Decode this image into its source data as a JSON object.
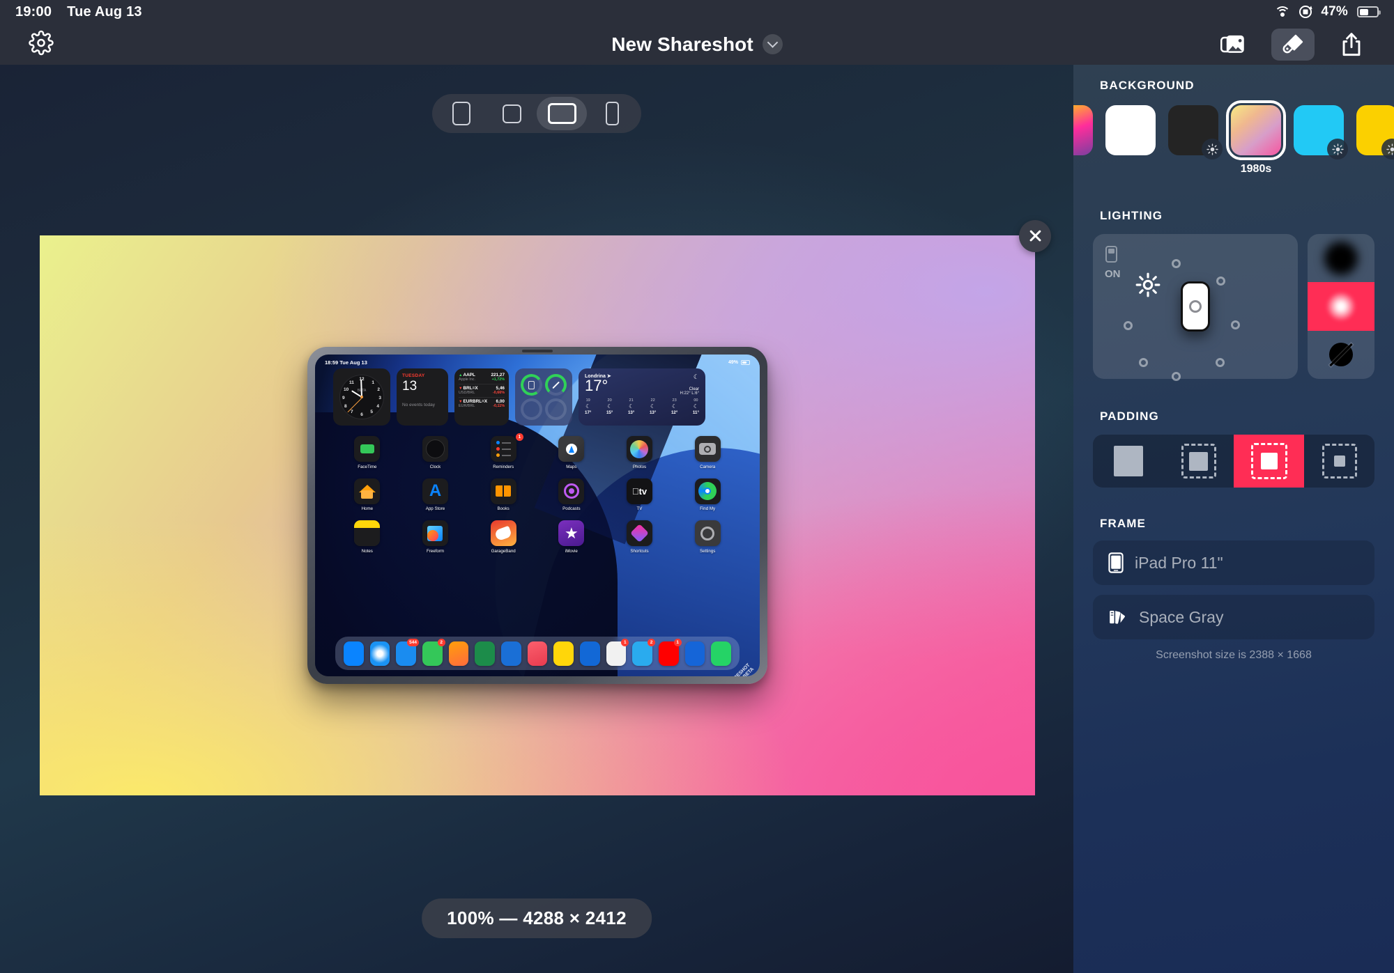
{
  "status_bar": {
    "time": "19:00",
    "date": "Tue Aug 13",
    "battery_percent": "47%",
    "wifi_icon": "wifi-icon",
    "rotation_lock_icon": "rotation-lock-icon",
    "battery_icon": "battery-icon"
  },
  "toolbar": {
    "settings_icon": "gear-icon",
    "title": "New Shareshot",
    "title_chevron_icon": "chevron-down-icon",
    "library_icon": "photo-library-icon",
    "style_icon": "paintbrush-icon",
    "share_icon": "share-icon"
  },
  "aspect_bar": {
    "options": [
      {
        "name": "portrait",
        "selected": false
      },
      {
        "name": "square",
        "selected": false
      },
      {
        "name": "landscape",
        "selected": true
      },
      {
        "name": "phone",
        "selected": false
      }
    ]
  },
  "canvas": {
    "close_icon": "close-icon",
    "zoom_badge": "100% — 4288 × 2412",
    "watermark_line1": "SHARESHOT",
    "watermark_line2": "BETA"
  },
  "device_screenshot": {
    "status": {
      "time": "18:59",
      "date": "Tue Aug 13",
      "battery_percent": "49%"
    },
    "widgets": {
      "clock": {
        "brand": "BETA",
        "numbers": [
          "12",
          "1",
          "2",
          "3",
          "4",
          "5",
          "6",
          "7",
          "8",
          "9",
          "10",
          "11"
        ]
      },
      "calendar": {
        "day_of_week": "TUESDAY",
        "day_number": "13",
        "events": "No events today"
      },
      "stocks": [
        {
          "symbol": "AAPL",
          "sub": "Apple Inc.",
          "price": "221,27",
          "change": "+1,72%",
          "dir": "up"
        },
        {
          "symbol": "BRL=X",
          "sub": "USD/BRL",
          "price": "5,46",
          "change": "-0,66%",
          "dir": "down"
        },
        {
          "symbol": "EURBRL=X",
          "sub": "EUR/BRL",
          "price": "6,00",
          "change": "-0,11%",
          "dir": "down"
        }
      ],
      "weather": {
        "city": "Londrina",
        "temp": "17°",
        "condition": "Clear",
        "high_low": "H:22° L:6°",
        "hours": [
          {
            "hour": "19",
            "icon": "moon-icon",
            "temp": "17°"
          },
          {
            "hour": "20",
            "icon": "moon-icon",
            "temp": "15°"
          },
          {
            "hour": "21",
            "icon": "moon-icon",
            "temp": "13°"
          },
          {
            "hour": "22",
            "icon": "moon-icon",
            "temp": "13°"
          },
          {
            "hour": "23",
            "icon": "moon-icon",
            "temp": "12°"
          },
          {
            "hour": "00",
            "icon": "moon-icon",
            "temp": "11°"
          }
        ]
      }
    },
    "apps": [
      {
        "label": "FaceTime",
        "badge": ""
      },
      {
        "label": "Clock",
        "badge": ""
      },
      {
        "label": "Reminders",
        "badge": "1"
      },
      {
        "label": "Maps",
        "badge": ""
      },
      {
        "label": "Photos",
        "badge": ""
      },
      {
        "label": "Camera",
        "badge": ""
      },
      {
        "label": "Home",
        "badge": ""
      },
      {
        "label": "App Store",
        "badge": ""
      },
      {
        "label": "Books",
        "badge": ""
      },
      {
        "label": "Podcasts",
        "badge": ""
      },
      {
        "label": "TV",
        "badge": ""
      },
      {
        "label": "Find My",
        "badge": ""
      },
      {
        "label": "Notes",
        "badge": ""
      },
      {
        "label": "Freeform",
        "badge": ""
      },
      {
        "label": "GarageBand",
        "badge": ""
      },
      {
        "label": "iMovie",
        "badge": ""
      },
      {
        "label": "Shortcuts",
        "badge": ""
      },
      {
        "label": "Settings",
        "badge": ""
      }
    ],
    "dock": [
      {
        "name": "files",
        "badge": ""
      },
      {
        "name": "safari",
        "badge": ""
      },
      {
        "name": "mail",
        "badge": "544"
      },
      {
        "name": "messages",
        "badge": "2"
      },
      {
        "name": "notes",
        "badge": ""
      },
      {
        "name": "numbers",
        "badge": ""
      },
      {
        "name": "keynote",
        "badge": ""
      },
      {
        "name": "music",
        "badge": ""
      },
      {
        "name": "stickies",
        "badge": ""
      },
      {
        "name": "maps",
        "badge": ""
      },
      {
        "name": "slack",
        "badge": "1"
      },
      {
        "name": "telegram",
        "badge": "2"
      },
      {
        "name": "youtube",
        "badge": "1"
      },
      {
        "name": "shortcuts",
        "badge": ""
      },
      {
        "name": "whatsapp",
        "badge": ""
      }
    ]
  },
  "panel": {
    "background": {
      "title": "BACKGROUND",
      "selected_label": "1980s",
      "swatches": [
        {
          "name": "gradient-warm",
          "selected": false,
          "has_brightness": false
        },
        {
          "name": "white",
          "selected": false,
          "has_brightness": false
        },
        {
          "name": "black",
          "selected": false,
          "has_brightness": true
        },
        {
          "name": "1980s",
          "selected": true,
          "has_brightness": false
        },
        {
          "name": "cyan",
          "selected": false,
          "has_brightness": true
        },
        {
          "name": "yellow",
          "selected": false,
          "has_brightness": true
        }
      ]
    },
    "lighting": {
      "title": "LIGHTING",
      "toggle_label": "ON",
      "device_icon": "device-icon",
      "sun_icon": "brightness-icon",
      "presets": [
        {
          "name": "soft-shadow",
          "selected": false
        },
        {
          "name": "glow",
          "selected": true
        },
        {
          "name": "no-shadow",
          "selected": false
        }
      ]
    },
    "padding": {
      "title": "PADDING",
      "options": [
        {
          "name": "none",
          "selected": false
        },
        {
          "name": "small",
          "selected": false
        },
        {
          "name": "medium",
          "selected": true
        },
        {
          "name": "large",
          "selected": false
        }
      ]
    },
    "frame": {
      "title": "FRAME",
      "device": {
        "label": "iPad Pro 11\"",
        "icon": "device-icon"
      },
      "color": {
        "label": "Space Gray",
        "icon": "color-swatch-icon"
      },
      "note": "Screenshot size is 2388 × 1668"
    }
  }
}
